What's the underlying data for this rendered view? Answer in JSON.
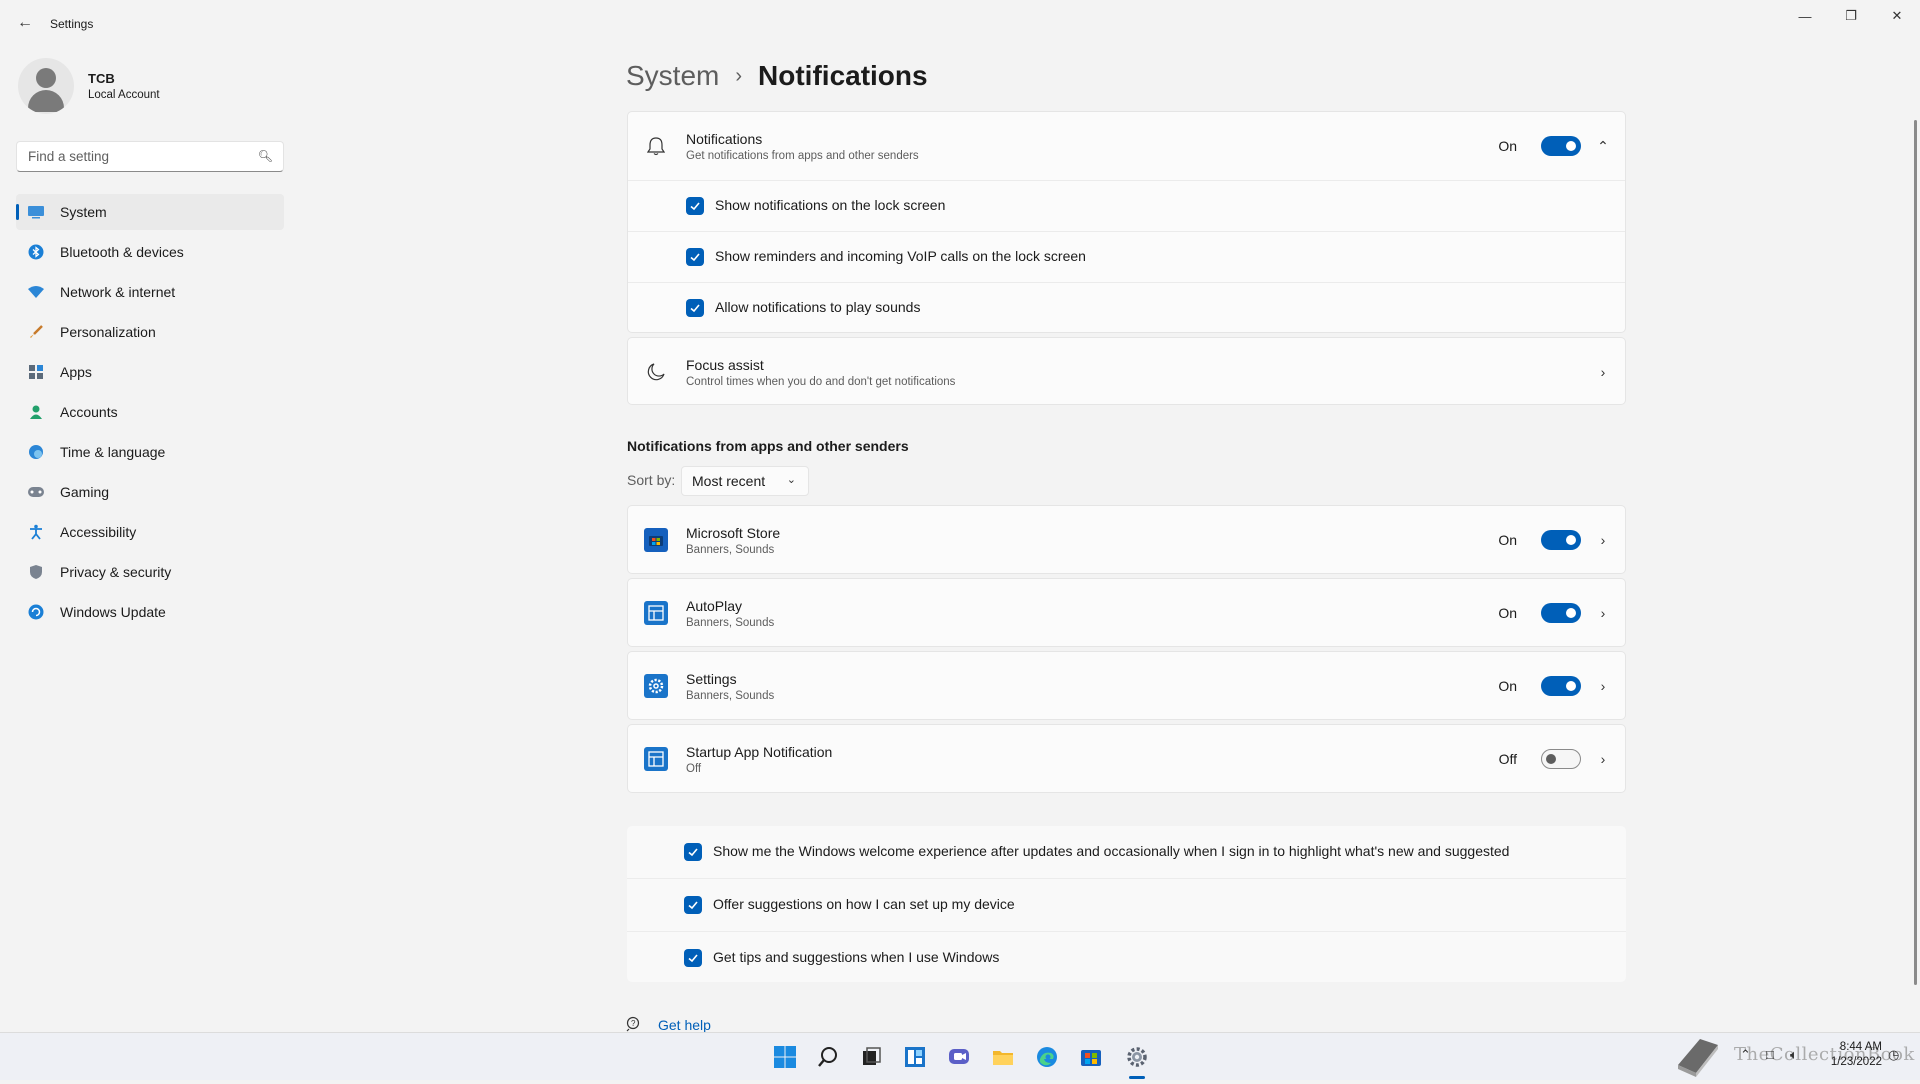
{
  "window": {
    "title": "Settings"
  },
  "profile": {
    "name": "TCB",
    "account_type": "Local Account"
  },
  "search": {
    "placeholder": "Find a setting"
  },
  "sidebar": {
    "items": [
      {
        "label": "System",
        "icon": "system-icon",
        "active": true
      },
      {
        "label": "Bluetooth & devices",
        "icon": "bluetooth-icon"
      },
      {
        "label": "Network & internet",
        "icon": "wifi-icon"
      },
      {
        "label": "Personalization",
        "icon": "brush-icon"
      },
      {
        "label": "Apps",
        "icon": "apps-icon"
      },
      {
        "label": "Accounts",
        "icon": "person-icon"
      },
      {
        "label": "Time & language",
        "icon": "globe-clock-icon"
      },
      {
        "label": "Gaming",
        "icon": "gamepad-icon"
      },
      {
        "label": "Accessibility",
        "icon": "accessibility-icon"
      },
      {
        "label": "Privacy & security",
        "icon": "shield-icon"
      },
      {
        "label": "Windows Update",
        "icon": "update-icon"
      }
    ]
  },
  "breadcrumb": {
    "parent": "System",
    "separator": "›",
    "current": "Notifications"
  },
  "notifications": {
    "title": "Notifications",
    "subtitle": "Get notifications from apps and other senders",
    "state_label": "On",
    "enabled": true,
    "options": [
      {
        "label": "Show notifications on the lock screen",
        "checked": true
      },
      {
        "label": "Show reminders and incoming VoIP calls on the lock screen",
        "checked": true
      },
      {
        "label": "Allow notifications to play sounds",
        "checked": true
      }
    ]
  },
  "focus_assist": {
    "title": "Focus assist",
    "subtitle": "Control times when you do and don't get notifications"
  },
  "apps_section": {
    "title": "Notifications from apps and other senders",
    "sort_label": "Sort by:",
    "sort_value": "Most recent",
    "apps": [
      {
        "name": "Microsoft Store",
        "detail": "Banners, Sounds",
        "state_label": "On",
        "enabled": true,
        "icon": "microsoft-store-icon"
      },
      {
        "name": "AutoPlay",
        "detail": "Banners, Sounds",
        "state_label": "On",
        "enabled": true,
        "icon": "autoplay-icon"
      },
      {
        "name": "Settings",
        "detail": "Banners, Sounds",
        "state_label": "On",
        "enabled": true,
        "icon": "settings-app-icon"
      },
      {
        "name": "Startup App Notification",
        "detail": "Off",
        "state_label": "Off",
        "enabled": false,
        "icon": "startup-app-icon"
      }
    ]
  },
  "additional": [
    {
      "label": "Show me the Windows welcome experience after updates and occasionally when I sign in to highlight what's new and suggested",
      "checked": true
    },
    {
      "label": "Offer suggestions on how I can set up my device",
      "checked": true
    },
    {
      "label": "Get tips and suggestions when I use Windows",
      "checked": true
    }
  ],
  "help": {
    "label": "Get help"
  },
  "taskbar": {
    "apps": [
      "start-icon",
      "search-icon",
      "task-view-icon",
      "widgets-icon",
      "chat-icon",
      "file-explorer-icon",
      "edge-icon",
      "store-icon",
      "settings-icon"
    ],
    "watermark": "TheCollectionBook",
    "time": "8:44 AM",
    "date": "1/23/2022"
  },
  "colors": {
    "accent": "#005fb8",
    "background": "#f3f3f3",
    "card": "#fbfbfb"
  }
}
